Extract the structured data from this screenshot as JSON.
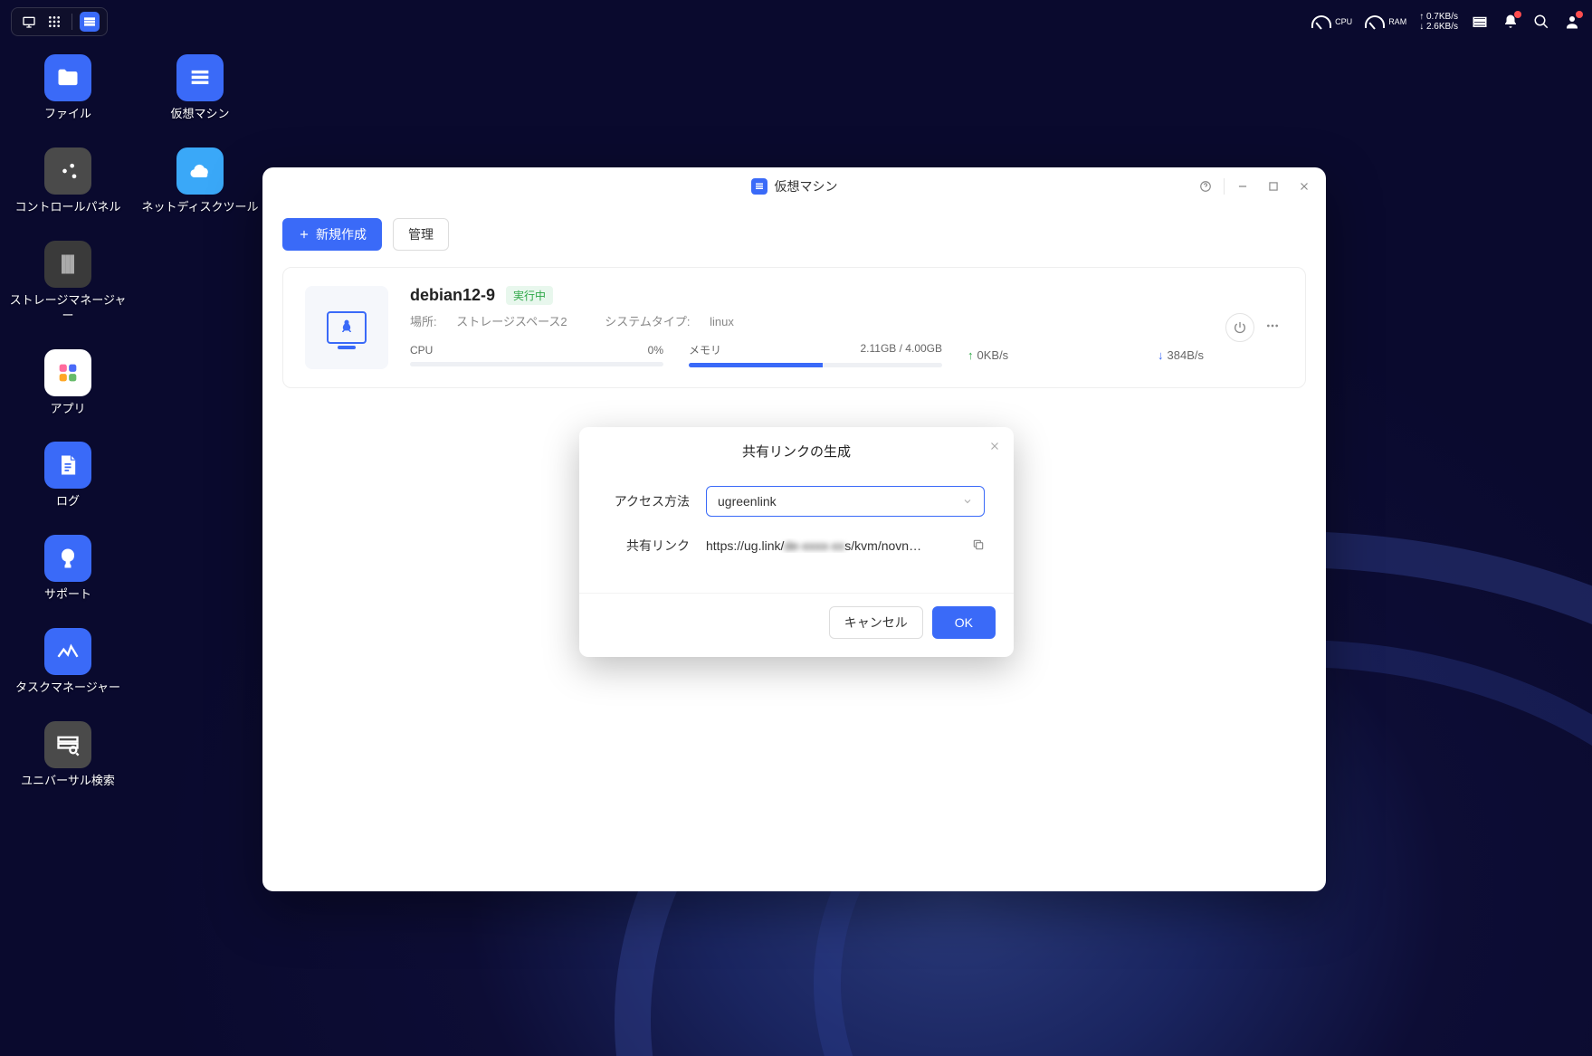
{
  "topbar": {
    "cpu_label": "CPU",
    "ram_label": "RAM",
    "net_up": "↑ 0.7KB/s",
    "net_down": "↓ 2.6KB/s"
  },
  "desktop_icons": [
    {
      "label": "ファイル",
      "color": "#3a6af8"
    },
    {
      "label": "仮想マシン",
      "color": "#3a6af8"
    },
    {
      "label": "コントロールパネル",
      "color": "#4a4a4a"
    },
    {
      "label": "ネットディスクツール",
      "color": "#3aa8f8"
    },
    {
      "label": "ストレージマネージャー",
      "color": "#3a3a3a"
    },
    {
      "label": "アプリ",
      "color": "#ffffff"
    },
    {
      "label": "ログ",
      "color": "#3a6af8"
    },
    {
      "label": "サポート",
      "color": "#3a6af8"
    },
    {
      "label": "タスクマネージャー",
      "color": "#3a6af8"
    },
    {
      "label": "ユニバーサル検索",
      "color": "#4a4a4a"
    }
  ],
  "window": {
    "title": "仮想マシン",
    "toolbar": {
      "new_label": "新規作成",
      "manage_label": "管理"
    },
    "vm": {
      "name": "debian12-9",
      "status": "実行中",
      "location_label": "場所:",
      "location_value": "ストレージスペース2",
      "systype_label": "システムタイプ:",
      "systype_value": "linux",
      "cpu_label": "CPU",
      "cpu_value": "0%",
      "cpu_percent": 0,
      "mem_label": "メモリ",
      "mem_value": "2.11GB / 4.00GB",
      "mem_percent": 53,
      "net_up": "0KB/s",
      "net_down": "384B/s"
    }
  },
  "modal": {
    "title": "共有リンクの生成",
    "access_label": "アクセス方法",
    "access_value": "ugreenlink",
    "link_label": "共有リンク",
    "link_prefix": "https://ug.link/",
    "link_hidden": "de-xxxx-xx",
    "link_suffix": "s/kvm/novn…",
    "cancel": "キャンセル",
    "ok": "OK"
  }
}
